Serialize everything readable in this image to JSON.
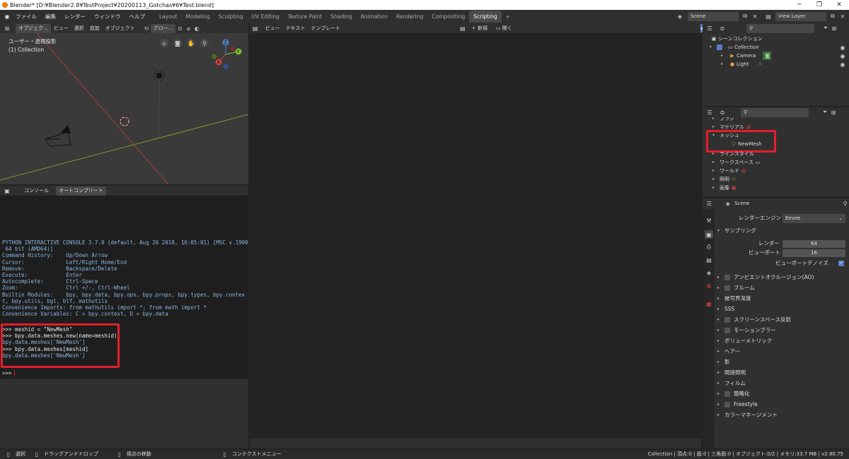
{
  "window": {
    "title": "Blender* [D:¥Blender2.8¥TestProject¥20200113_Gotchas¥6¥Test.blend]",
    "controls": [
      "─",
      "❐",
      "✕"
    ]
  },
  "menu": [
    "ファイル",
    "編集",
    "レンダー",
    "ウィンドウ",
    "ヘルプ"
  ],
  "workspace_tabs": [
    "Layout",
    "Modeling",
    "Sculpting",
    "UV Editing",
    "Texture Paint",
    "Shading",
    "Animation",
    "Rendering",
    "Compositing",
    "Scripting"
  ],
  "workspace_add": "+",
  "scene": {
    "name": "Scene",
    "view_layer": "View Layer"
  },
  "viewport": {
    "header": [
      "オブジェク...",
      "ビュー",
      "選択",
      "追加",
      "オブジェクト",
      "グロー..."
    ],
    "view_name": "ユーザー・透視投影",
    "collection": "(1) Collection",
    "gizmo_labels": [
      "Z",
      "Y",
      "X"
    ]
  },
  "console": {
    "tabs": [
      "コンソール",
      "オートコンプリート"
    ],
    "intro": [
      "PYTHON INTERACTIVE CONSOLE 3.7.0 (default, Aug 26 2018, 16:05:01) [MSC v.1900",
      " 64 bit (AMD64)]",
      "",
      "Command History:    Up/Down Arrow",
      "Cursor:             Left/Right Home/End",
      "Remove:             Backspace/Delete",
      "Execute:            Enter",
      "Autocomplete:       Ctrl-Space",
      "Zoom:               Ctrl +/-, Ctrl-Wheel",
      "Builtin Modules:    bpy, bpy.data, bpy.ops, bpy.props, bpy.types, bpy.contex",
      "t, bpy.utils, bgl, blf, mathutils",
      "Convenience Imports: from mathutils import *; from math import *",
      "Convenience Variables: C = bpy.context, D = bpy.data"
    ],
    "commands": [
      {
        "text": ">>> meshid = \"NewMesh\"",
        "kind": "input"
      },
      {
        "text": ">>> bpy.data.meshes.new(name=meshid)",
        "kind": "input"
      },
      {
        "text": "bpy.data.meshes['NewMesh']",
        "kind": "output"
      },
      {
        "text": "",
        "kind": "input"
      },
      {
        "text": ">>> bpy.data.meshes[meshid]",
        "kind": "input"
      },
      {
        "text": "bpy.data.meshes['NewMesh']",
        "kind": "output"
      }
    ],
    "prompt": ">>>"
  },
  "text_editor": {
    "header": [
      "ビュー",
      "テキスト",
      "テンプレート"
    ],
    "new_label": "新規",
    "open_label": "開く"
  },
  "outliner": {
    "root": "シーンコレクション",
    "items": [
      {
        "label": "Collection",
        "level": 1
      },
      {
        "label": "Camera",
        "level": 2
      },
      {
        "label": "Light",
        "level": 2
      }
    ]
  },
  "datablocks": {
    "items": [
      {
        "label": "ブラシ",
        "expanded": false
      },
      {
        "label": "マテリアル",
        "expanded": false
      },
      {
        "label": "メッシュ",
        "expanded": true
      },
      {
        "label": "NewMesh",
        "child": true
      },
      {
        "label": "ラインスタイル",
        "expanded": false
      },
      {
        "label": "ワークスペース",
        "expanded": false
      },
      {
        "label": "ワールド",
        "expanded": false
      },
      {
        "label": "照明",
        "expanded": false
      },
      {
        "label": "画像",
        "expanded": false
      }
    ]
  },
  "properties": {
    "scene": "Scene",
    "render_engine_label": "レンダーエンジン",
    "render_engine": "Eevee",
    "sampling": "サンプリング",
    "render_samples_label": "レンダー",
    "render_samples": "64",
    "viewport_samples_label": "ビューポート",
    "viewport_samples": "16",
    "viewport_denoise": "ビューポートデノイズ",
    "sections": [
      {
        "label": "アンビエントオクルージョン(AO)",
        "check": true
      },
      {
        "label": "ブルーム",
        "check": true
      },
      {
        "label": "被写界深度",
        "check": false
      },
      {
        "label": "SSS",
        "check": false
      },
      {
        "label": "スクリーンスペース反射",
        "check": true
      },
      {
        "label": "モーションブラー",
        "check": true
      },
      {
        "label": "ボリューメトリック",
        "check": false
      },
      {
        "label": "ヘアー",
        "check": false
      },
      {
        "label": "影",
        "check": false
      },
      {
        "label": "間接照明",
        "check": false
      },
      {
        "label": "フィルム",
        "check": false
      },
      {
        "label": "簡略化",
        "check": true
      },
      {
        "label": "Freestyle",
        "check": true
      },
      {
        "label": "カラーマネージメント",
        "check": false
      }
    ]
  },
  "statusbar": {
    "select": "選択",
    "drag": "ドラッグアンドドロップ",
    "move_view": "視点の移動",
    "context": "コンテクストメニュー",
    "stats": "Collection | 頂点:0 | 面:0 | 三角面:0 | オブジェクト:0/2 | メモリ:33.7 MB | v2.80.75"
  },
  "colors": {
    "highlight": "#e41d2d",
    "accent_blue": "#5680c2"
  }
}
